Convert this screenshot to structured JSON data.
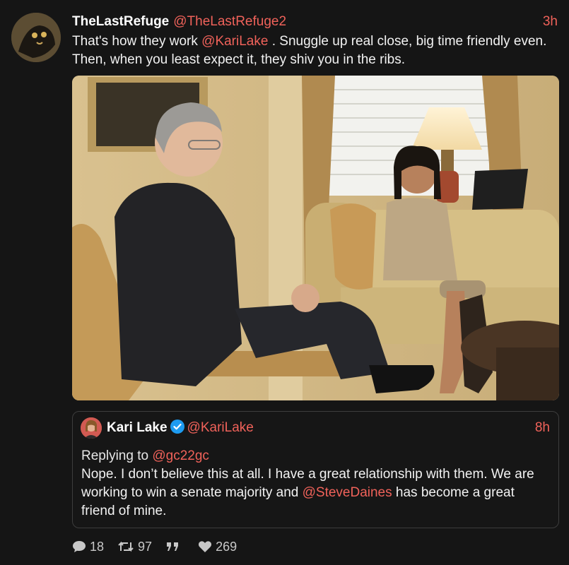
{
  "tweet": {
    "display_name": "TheLastRefuge",
    "handle": "@TheLastRefuge2",
    "time": "3h",
    "text_part1": "That's how they work ",
    "mention": "@KariLake",
    "text_part2": " .  Snuggle up real close, big time friendly even.  Then, when you least expect it, they shiv you in the ribs."
  },
  "quote": {
    "display_name": "Kari Lake",
    "handle": "@KariLake",
    "time": "8h",
    "replying_prefix": "Replying to ",
    "replying_to": "@gc22gc",
    "text_part1": "Nope. I don’t believe this at all. I have a great relationship with them. We are working to win a senate majority and ",
    "mention": "@SteveDaines",
    "text_part2": " has become a great friend of mine."
  },
  "actions": {
    "replies": "18",
    "retweets": "97",
    "quotes_icon": "quote-icon",
    "likes": "269"
  },
  "colors": {
    "background": "#151515",
    "accent": "#f0625a",
    "verified": "#1d9bf0"
  }
}
